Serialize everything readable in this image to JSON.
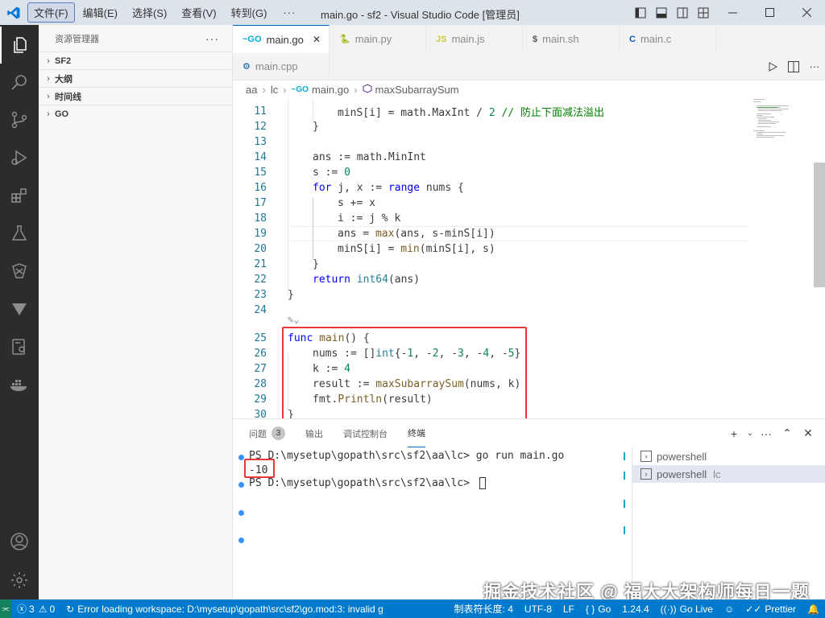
{
  "window": {
    "title": "main.go - sf2 - Visual Studio Code [管理员]",
    "menu": [
      "文件(F)",
      "编辑(E)",
      "选择(S)",
      "查看(V)",
      "转到(G)"
    ],
    "menu_more": "···"
  },
  "sidebar": {
    "title": "资源管理器",
    "more": "···",
    "sections": [
      "SF2",
      "大纲",
      "时间线",
      "GO"
    ]
  },
  "tabs": {
    "row1": [
      {
        "icon": "~GO",
        "label": "main.go",
        "active": true,
        "icon_color": "#00add8"
      },
      {
        "icon": "🐍",
        "label": "main.py",
        "active": false,
        "icon_color": "#3572a5"
      },
      {
        "icon": "JS",
        "label": "main.js",
        "active": false,
        "icon_color": "#cbcb41"
      },
      {
        "icon": "$",
        "label": "main.sh",
        "active": false,
        "icon_color": "#4d5a5e"
      },
      {
        "icon": "C",
        "label": "main.c",
        "active": false,
        "icon_color": "#005fb8"
      }
    ],
    "row2": [
      {
        "icon": "⚙",
        "label": "main.cpp",
        "active": false,
        "icon_color": "#00599c"
      }
    ],
    "close": "✕"
  },
  "breadcrumb": [
    "aa",
    "lc",
    "main.go",
    "maxSubarraySum"
  ],
  "editor": {
    "lines": [
      {
        "n": "11",
        "indent": 2,
        "tokens": [
          [
            "minS[i] = math.MaxInt / ",
            ""
          ],
          [
            "2",
            "num"
          ],
          [
            " // 防止下面减法溢出",
            "cm"
          ]
        ]
      },
      {
        "n": "12",
        "indent": 1,
        "tokens": [
          [
            "}",
            ""
          ]
        ]
      },
      {
        "n": "13",
        "indent": 0,
        "tokens": []
      },
      {
        "n": "14",
        "indent": 1,
        "tokens": [
          [
            "ans := math.MinInt",
            ""
          ]
        ]
      },
      {
        "n": "15",
        "indent": 1,
        "tokens": [
          [
            "s := ",
            ""
          ],
          [
            "0",
            "num"
          ]
        ]
      },
      {
        "n": "16",
        "indent": 1,
        "tokens": [
          [
            "for",
            "kw"
          ],
          [
            " j, x := ",
            ""
          ],
          [
            "range",
            "kw"
          ],
          [
            " nums {",
            ""
          ]
        ]
      },
      {
        "n": "17",
        "indent": 2,
        "tokens": [
          [
            "s += x",
            ""
          ]
        ]
      },
      {
        "n": "18",
        "indent": 2,
        "tokens": [
          [
            "i := j % k",
            ""
          ]
        ]
      },
      {
        "n": "19",
        "indent": 2,
        "tokens": [
          [
            "ans = ",
            ""
          ],
          [
            "max",
            "fn"
          ],
          [
            "(ans, s-minS[i])",
            ""
          ]
        ]
      },
      {
        "n": "20",
        "indent": 2,
        "tokens": [
          [
            "minS[i] = ",
            ""
          ],
          [
            "min",
            "fn"
          ],
          [
            "(minS[i], s)",
            ""
          ]
        ]
      },
      {
        "n": "21",
        "indent": 1,
        "tokens": [
          [
            "}",
            ""
          ]
        ]
      },
      {
        "n": "22",
        "indent": 1,
        "tokens": [
          [
            "return",
            "kw"
          ],
          [
            " ",
            ""
          ],
          [
            "int64",
            "ty"
          ],
          [
            "(ans)",
            ""
          ]
        ]
      },
      {
        "n": "23",
        "indent": 0,
        "tokens": [
          [
            "}",
            ""
          ]
        ]
      },
      {
        "n": "24",
        "indent": 0,
        "tokens": []
      },
      {
        "n": "25",
        "indent": 0,
        "tokens": [
          [
            "func",
            "kw"
          ],
          [
            " ",
            ""
          ],
          [
            "main",
            "fn"
          ],
          [
            "() {",
            ""
          ]
        ]
      },
      {
        "n": "26",
        "indent": 1,
        "tokens": [
          [
            "nums := []",
            ""
          ],
          [
            "int",
            "ty"
          ],
          [
            "{-",
            ""
          ],
          [
            "1",
            "num"
          ],
          [
            ", -",
            ""
          ],
          [
            "2",
            "num"
          ],
          [
            ", -",
            ""
          ],
          [
            "3",
            "num"
          ],
          [
            ", -",
            ""
          ],
          [
            "4",
            "num"
          ],
          [
            ", -",
            ""
          ],
          [
            "5",
            "num"
          ],
          [
            "}",
            ""
          ]
        ]
      },
      {
        "n": "27",
        "indent": 1,
        "tokens": [
          [
            "k := ",
            ""
          ],
          [
            "4",
            "num"
          ]
        ]
      },
      {
        "n": "28",
        "indent": 1,
        "tokens": [
          [
            "result := ",
            ""
          ],
          [
            "maxSubarraySum",
            "fn"
          ],
          [
            "(nums, k)",
            ""
          ]
        ]
      },
      {
        "n": "29",
        "indent": 1,
        "tokens": [
          [
            "fmt.",
            ""
          ],
          [
            "Println",
            "fn"
          ],
          [
            "(result)",
            ""
          ]
        ]
      },
      {
        "n": "30",
        "indent": 0,
        "tokens": [
          [
            "}",
            ""
          ]
        ]
      }
    ]
  },
  "panel": {
    "tabs": [
      "问题",
      "输出",
      "调试控制台",
      "终端"
    ],
    "problems_count": "3",
    "active_tab": "终端",
    "terminal": [
      "PS D:\\mysetup\\gopath\\src\\sf2\\aa\\lc> go run main.go",
      "-10",
      "PS D:\\mysetup\\gopath\\src\\sf2\\aa\\lc> "
    ],
    "terminal_list": [
      {
        "label": "powershell",
        "sub": ""
      },
      {
        "label": "powershell",
        "sub": "lc"
      }
    ]
  },
  "statusbar": {
    "errors": "3",
    "warnings": "0",
    "message": "Error loading workspace: D:\\mysetup\\gopath\\src\\sf2\\go.mod:3: invalid g",
    "tab_size": "制表符长度: 4",
    "encoding": "UTF-8",
    "eol": "LF",
    "language": "Go",
    "go_version": "1.24.4",
    "go_live": "Go Live",
    "prettier": "Prettier"
  },
  "watermark": "掘金技术社区 @ 福大大架构师每日一题"
}
